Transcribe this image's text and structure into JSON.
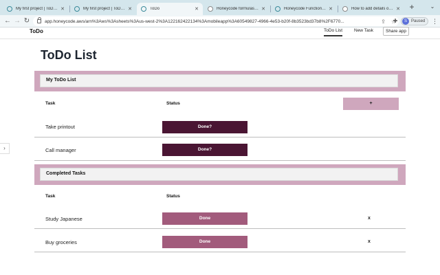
{
  "browser": {
    "tabs": [
      {
        "title": "My first project | ToDo | Am",
        "active": false
      },
      {
        "title": "My first project | ToDo | Am",
        "active": false
      },
      {
        "title": "ToDo",
        "active": true
      },
      {
        "title": "Honeycode formulas - Goo",
        "active": false
      },
      {
        "title": "Honeycode Functions - Kno",
        "active": false
      },
      {
        "title": "How to add details of a scr",
        "active": false
      }
    ],
    "url": "app.honeycode.aws/arn%3Aws%3Asheets%3Aus-west-2%3A122162422134%3Amobileapp%3A60549827-4966-4e53-b20f-8b3523bd37b8%2F6770...",
    "profile_initial": "S",
    "profile_status": "Paused",
    "icons": [
      "back-icon",
      "forward-icon",
      "reload-icon",
      "lock-icon",
      "share-icon",
      "star-icon",
      "puzzle-icon",
      "profile-icon",
      "menu-icon"
    ]
  },
  "app": {
    "title": "ToDo",
    "nav_tabs": [
      "ToDo List",
      "New Task"
    ],
    "share_label": "Share app",
    "expander": "›"
  },
  "page": {
    "title": "ToDo List",
    "todo_section": {
      "title": "My ToDo List",
      "col_task": "Task",
      "col_status": "Status",
      "add_label": "+",
      "rows": [
        {
          "task": "Take printout",
          "status": "Done?"
        },
        {
          "task": "Call manager",
          "status": "Done?"
        }
      ]
    },
    "completed_section": {
      "title": "Completed Tasks",
      "col_task": "Task",
      "col_status": "Status",
      "rows": [
        {
          "task": "Study Japanese",
          "status": "Done",
          "delete": "x"
        },
        {
          "task": "Buy groceries",
          "status": "Done",
          "delete": "x"
        }
      ]
    }
  },
  "colors": {
    "section_band": "#cfa7bd",
    "todo_button": "#4a1533",
    "done_button": "#a25b7c",
    "tabstrip": "#d4e6ec"
  }
}
